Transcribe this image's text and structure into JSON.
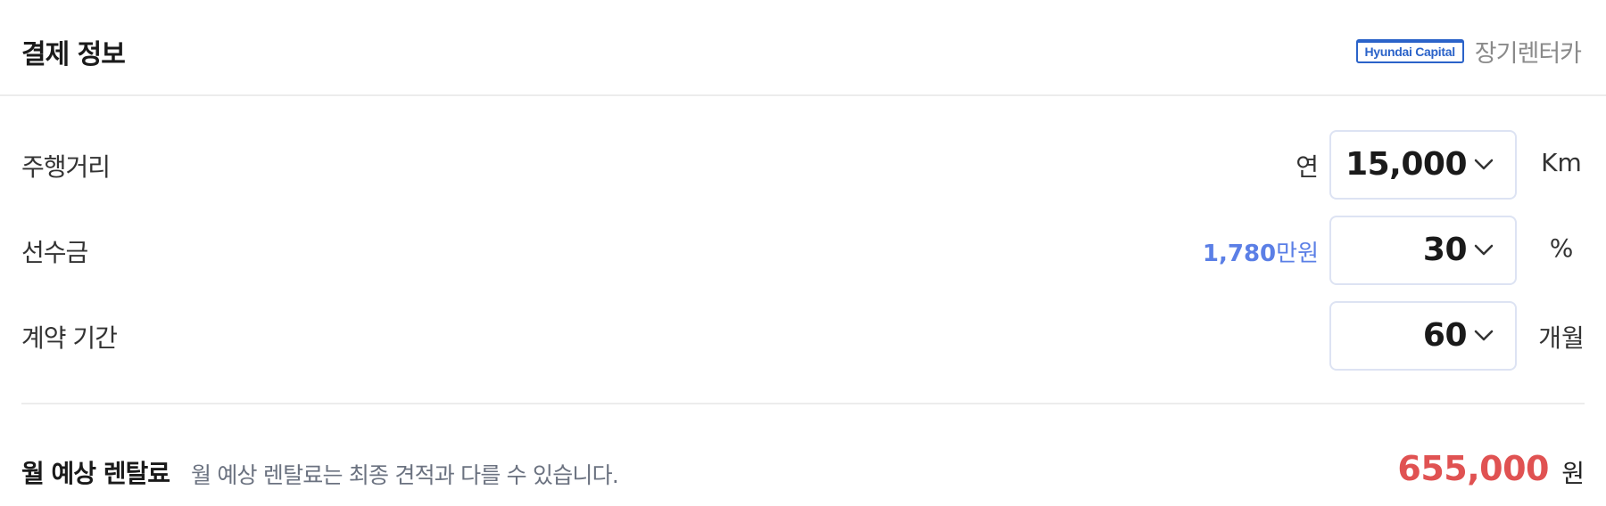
{
  "header": {
    "title": "결제 정보",
    "brand_logo_text": "Hyundai Capital",
    "brand_name": "장기렌터카"
  },
  "rows": [
    {
      "label": "주행거리",
      "prefix": "연",
      "value": "15,000",
      "unit": "Km"
    },
    {
      "label": "선수금",
      "prefix_amount": "1,780",
      "prefix_unit": "만원",
      "value": "30",
      "unit": "%"
    },
    {
      "label": "계약 기간",
      "value": "60",
      "unit": "개월"
    }
  ],
  "footer": {
    "label": "월 예상 렌탈료",
    "note": "월 예상 렌탈료는 최종 견적과 다를 수 있습니다.",
    "price": "655,000",
    "unit": "원"
  },
  "colors": {
    "accent_blue": "#5b7fe6",
    "price_red": "#e05252",
    "brand_blue": "#2b63c9",
    "select_border": "#dde3f3"
  },
  "icons": {
    "dropdown": "chevron-down-icon"
  }
}
